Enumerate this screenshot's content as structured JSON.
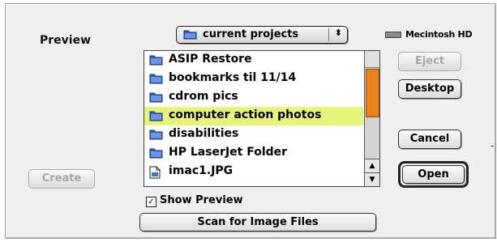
{
  "preview_label": "Preview",
  "location_popup": {
    "label": "current projects",
    "arrow": "⬍"
  },
  "volume": {
    "label": "Mecintosh HD"
  },
  "files": [
    {
      "name": "ASIP Restore",
      "icon": "folder-icon",
      "selected": false
    },
    {
      "name": "bookmarks til 11/14",
      "icon": "folder-icon",
      "selected": false
    },
    {
      "name": "cdrom pics",
      "icon": "folder-icon",
      "selected": false
    },
    {
      "name": "computer action photos",
      "icon": "folder-icon",
      "selected": true
    },
    {
      "name": "disabilities",
      "icon": "folder-icon",
      "selected": false
    },
    {
      "name": "HP LaserJet Folder",
      "icon": "folder-icon",
      "selected": false
    },
    {
      "name": "imac1.JPG",
      "icon": "document-icon",
      "selected": false
    }
  ],
  "buttons": {
    "eject": "Eject",
    "desktop": "Desktop",
    "cancel": "Cancel",
    "open": "Open",
    "create": "Create",
    "scan": "Scan for Image Files"
  },
  "show_preview": {
    "label": "Show Preview",
    "checked": true
  },
  "colors": {
    "selection": "#e8f37c",
    "scroll_thumb": "#e8821e",
    "folder": "#2f62c8"
  }
}
